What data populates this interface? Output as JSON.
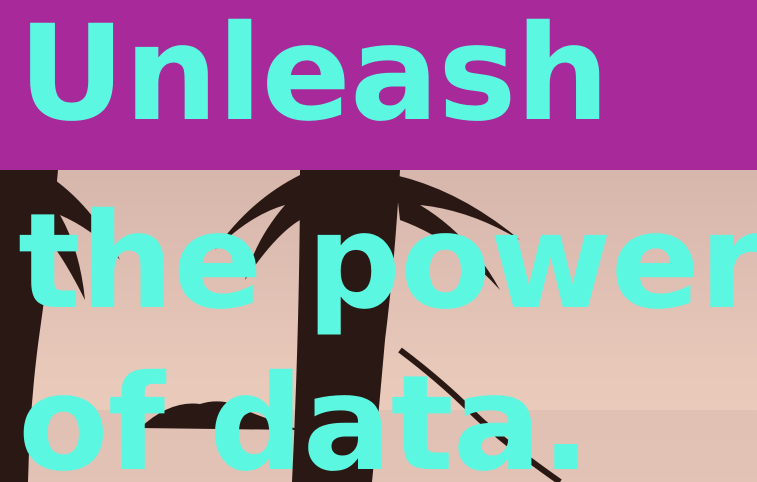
{
  "headline": {
    "lines": [
      "Unleash",
      "the power",
      "of data."
    ]
  },
  "colors": {
    "band": "#a8299a",
    "text": "#5cf7e1",
    "sky_top": "#c9a6a1",
    "sky_bottom": "#f0d2c0",
    "silhouette": "#2a1814"
  },
  "photo": {
    "subject": "palm-tree-beach-sunset"
  }
}
